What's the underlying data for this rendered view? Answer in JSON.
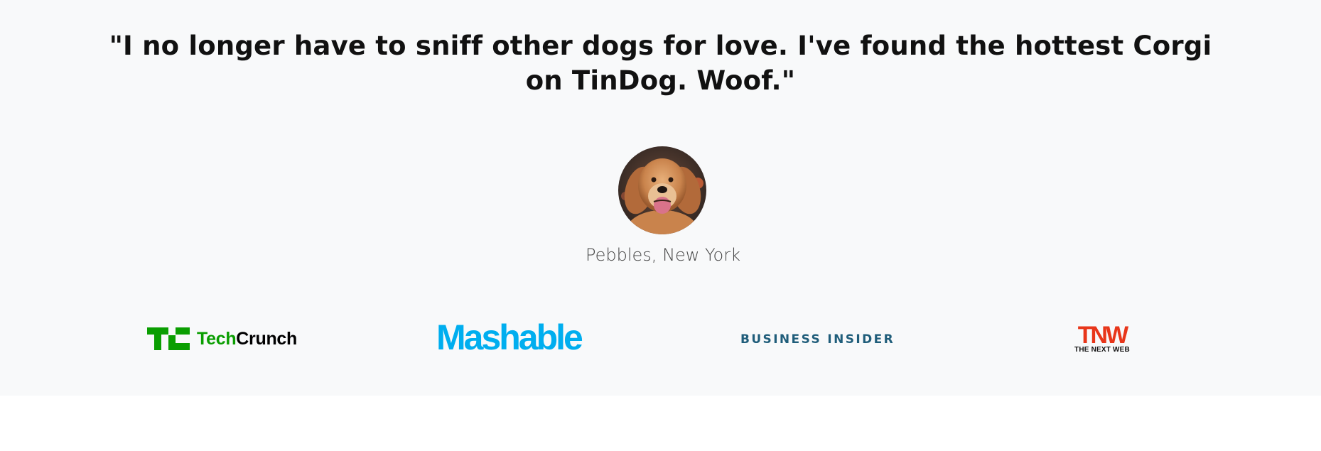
{
  "testimonial": {
    "quote": "\"I no longer have to sniff other dogs for love. I've found the hottest Corgi on TinDog. Woof.\"",
    "author": "Pebbles, New York"
  },
  "press_logos": {
    "techcrunch": {
      "part1": "Tech",
      "part2": "Crunch"
    },
    "mashable": {
      "text": "Mashable"
    },
    "business_insider": {
      "text": "BUSINESS INSIDER"
    },
    "tnw": {
      "text": "TNW",
      "subtitle": "THE NEXT WEB"
    }
  },
  "colors": {
    "section_background": "#f8f9fa",
    "techcrunch_green": "#0a9e01",
    "mashable_blue": "#00aeef",
    "business_insider_blue": "#1f5d7a",
    "tnw_red": "#e8361a"
  }
}
